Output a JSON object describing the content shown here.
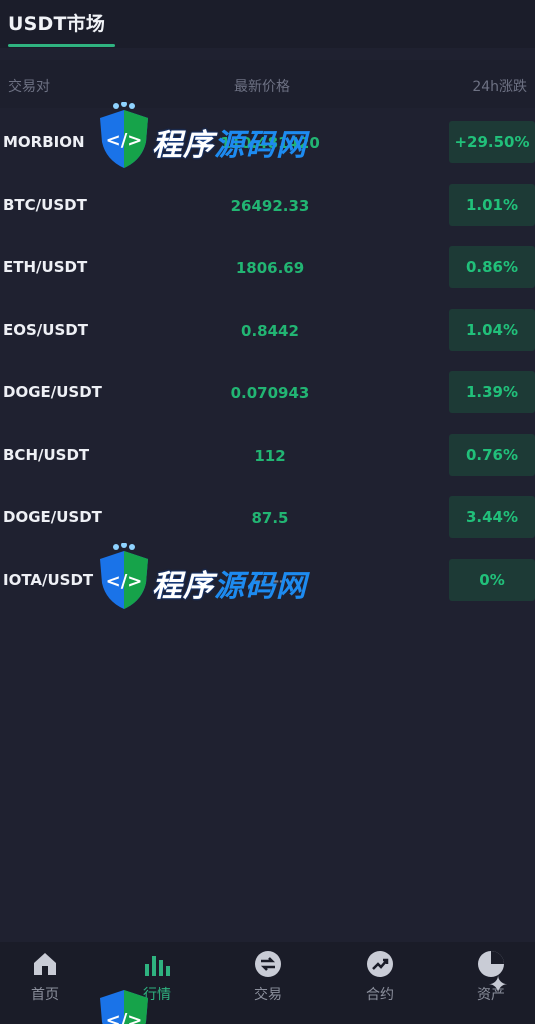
{
  "header": {
    "tab_label": "USDT市场"
  },
  "columns": {
    "pair": "交易对",
    "price": "最新价格",
    "change": "24h涨跌"
  },
  "rows": [
    {
      "pair": "MORBION",
      "price": "110.481420",
      "change": "+29.50%"
    },
    {
      "pair": "BTC/USDT",
      "price": "26492.33",
      "change": "1.01%"
    },
    {
      "pair": "ETH/USDT",
      "price": "1806.69",
      "change": "0.86%"
    },
    {
      "pair": "EOS/USDT",
      "price": "0.8442",
      "change": "1.04%"
    },
    {
      "pair": "DOGE/USDT",
      "price": "0.070943",
      "change": "1.39%"
    },
    {
      "pair": "BCH/USDT",
      "price": "112",
      "change": "0.76%"
    },
    {
      "pair": "DOGE/USDT",
      "price": "87.5",
      "change": "3.44%"
    },
    {
      "pair": "IOTA/USDT",
      "price": "--.--",
      "change": "0%"
    }
  ],
  "watermark": {
    "text_a": "程序",
    "text_b": "源码网"
  },
  "nav": [
    {
      "label": "首页",
      "icon": "home-icon"
    },
    {
      "label": "行情",
      "icon": "market-chart-icon"
    },
    {
      "label": "交易",
      "icon": "exchange-icon"
    },
    {
      "label": "合约",
      "icon": "contract-trend-icon"
    },
    {
      "label": "资产",
      "icon": "asset-pie-icon"
    }
  ],
  "colors": {
    "background": "#1f2130",
    "accent": "#2fb380",
    "rise": "#22b573",
    "badge_bg": "#1d3a36"
  }
}
